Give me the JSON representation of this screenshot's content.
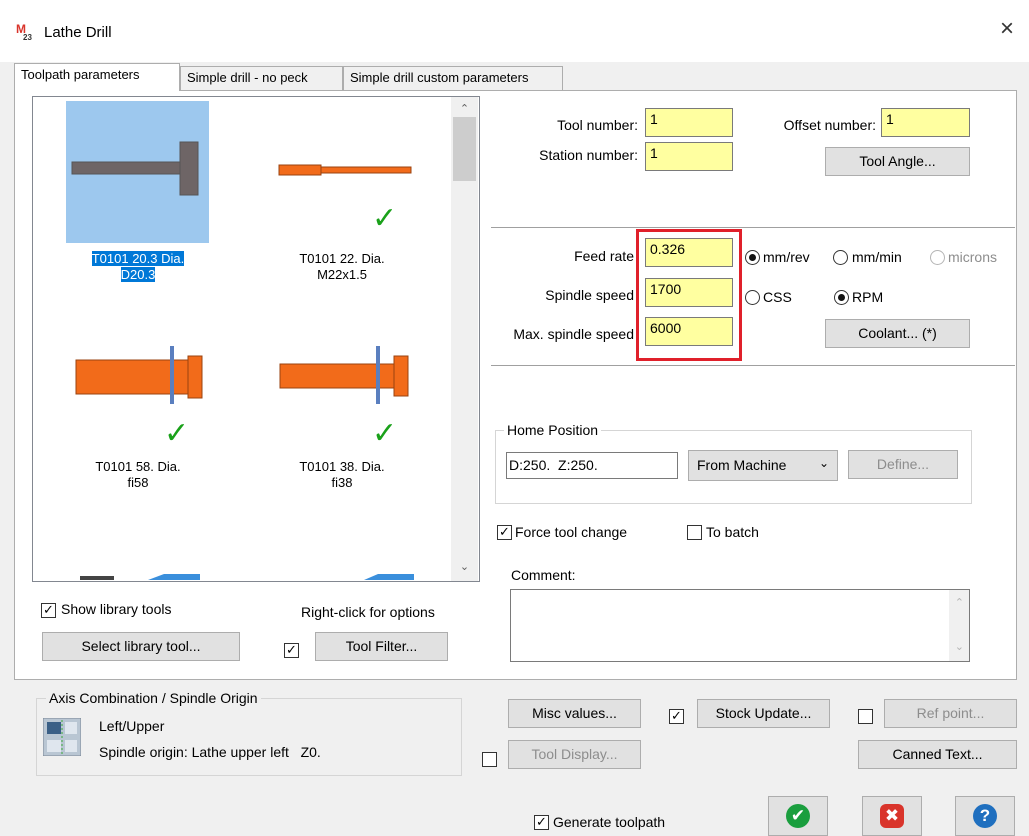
{
  "window": {
    "title": "Lathe Drill",
    "close_glyph": "×",
    "logo_icon": "mastercam-logo"
  },
  "tabs": [
    {
      "label": "Toolpath parameters",
      "active": true
    },
    {
      "label": "Simple drill - no peck",
      "active": false
    },
    {
      "label": "Simple drill custom parameters",
      "active": false
    }
  ],
  "tools": [
    {
      "line1": "T0101 20.3 Dia.",
      "line2": "D20.3",
      "selected": true,
      "checked": false
    },
    {
      "line1": "T0101 22. Dia.",
      "line2": "M22x1.5",
      "selected": false,
      "checked": true
    },
    {
      "line1": "T0101 58. Dia.",
      "line2": "fi58",
      "selected": false,
      "checked": true
    },
    {
      "line1": "T0101 38. Dia.",
      "line2": "fi38",
      "selected": false,
      "checked": true
    }
  ],
  "tool_fields": {
    "tool_number_label": "Tool number:",
    "tool_number": "1",
    "offset_number_label": "Offset number:",
    "offset_number": "1",
    "station_number_label": "Station number:",
    "station_number": "1",
    "tool_angle_button": "Tool Angle..."
  },
  "feed": {
    "feed_rate_label": "Feed rate",
    "feed_rate": "0.326",
    "spindle_speed_label": "Spindle speed",
    "spindle_speed": "1700",
    "max_spindle_label": "Max. spindle speed",
    "max_spindle": "6000",
    "unit_mm_rev": "mm/rev",
    "unit_mm_min": "mm/min",
    "unit_microns": "microns",
    "css": "CSS",
    "rpm": "RPM",
    "coolant_button": "Coolant... (*)",
    "highlight_color": "#e0202a"
  },
  "home": {
    "title": "Home Position",
    "value": "D:250.  Z:250.",
    "mode": "From Machine",
    "define_button": "Define..."
  },
  "options": {
    "force_tool_change": "Force tool change",
    "to_batch": "To batch",
    "comment_label": "Comment:"
  },
  "library": {
    "show_library_tools": "Show library tools",
    "right_click": "Right-click for options",
    "select_library_tool": "Select library tool...",
    "tool_filter": "Tool Filter..."
  },
  "axis": {
    "title": "Axis Combination / Spindle Origin",
    "combo": "Left/Upper",
    "origin": "Spindle origin: Lathe upper left   Z0."
  },
  "misc": {
    "misc_values": "Misc values...",
    "stock_update": "Stock Update...",
    "ref_point": "Ref point...",
    "tool_display": "Tool Display...",
    "canned_text": "Canned Text..."
  },
  "footer": {
    "generate_toolpath": "Generate toolpath",
    "ok_icon": "ok-icon",
    "cancel_icon": "cancel-icon",
    "help_icon": "help-icon",
    "ok_glyph": "✔",
    "cancel_glyph": "✖",
    "help_glyph": "?",
    "ok_color": "#1a9e3e",
    "cancel_color": "#d9342b",
    "help_color": "#1f6fbf"
  },
  "colors": {
    "tool_body": "#f26b1a",
    "tool_selected_bg": "#9dc8ee",
    "tool_gray": "#6e6566",
    "check_green": "#1aa11a"
  }
}
